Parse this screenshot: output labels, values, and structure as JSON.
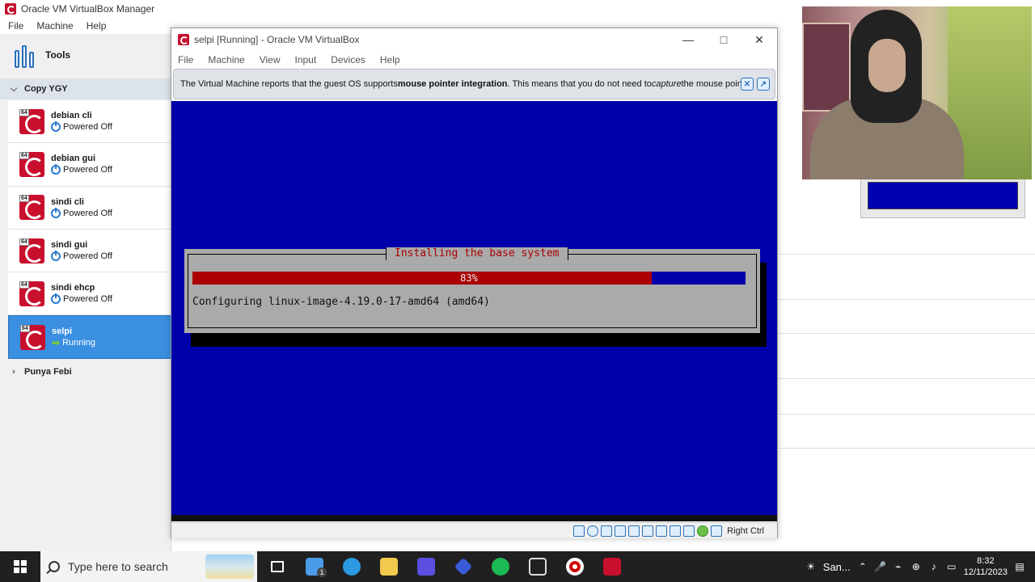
{
  "manager": {
    "title": "Oracle VM VirtualBox Manager",
    "menu": [
      "File",
      "Machine",
      "Help"
    ],
    "tools_label": "Tools",
    "groups": {
      "copy_label": "Copy YGY",
      "punya_label": "Punya Febi"
    },
    "vms": [
      {
        "name": "debian cli",
        "status": "Powered Off",
        "state": "off"
      },
      {
        "name": "debian gui",
        "status": "Powered Off",
        "state": "off"
      },
      {
        "name": "sindi cli",
        "status": "Powered Off",
        "state": "off"
      },
      {
        "name": "sindi gui",
        "status": "Powered Off",
        "state": "off"
      },
      {
        "name": "sindi ehcp",
        "status": "Powered Off",
        "state": "off"
      },
      {
        "name": "selpi",
        "status": "Running",
        "state": "running"
      }
    ],
    "badge": "64"
  },
  "vm_window": {
    "title": "selpi [Running] - Oracle VM VirtualBox",
    "menu": [
      "File",
      "Machine",
      "View",
      "Input",
      "Devices",
      "Help"
    ],
    "notice": {
      "part1": "The Virtual Machine reports that the guest OS supports ",
      "bold": "mouse pointer integration",
      "part2": ". This means that you do not need to ",
      "italic": "capture",
      "part3": " the mouse pointer"
    },
    "installer": {
      "title": "Installing the base system",
      "progress_label": "83%",
      "progress_fraction": 0.83,
      "message": "Configuring linux-image-4.19.0-17-amd64 (amd64)"
    },
    "status_host_key": "Right Ctrl"
  },
  "taskbar": {
    "search_placeholder": "Type here to search",
    "weather_label": "San...",
    "time": "8:32",
    "date": "12/11/2023",
    "mail_badge": "1"
  },
  "colors": {
    "guest_bg": "#0000aa",
    "progress_fill": "#aa0000",
    "dialog_bg": "#aaaaaa",
    "selected_vm": "#3a8fe0"
  }
}
